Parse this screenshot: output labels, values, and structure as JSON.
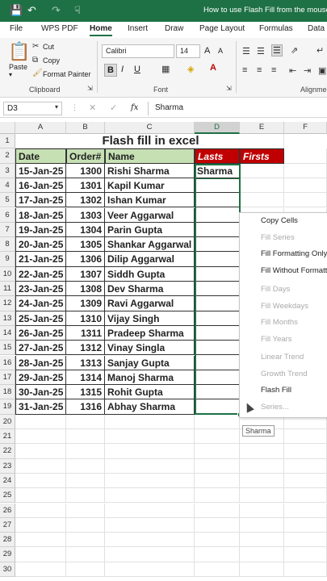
{
  "titlebar": {
    "title": "How to use Flash Fill from the mouse in",
    "save_icon": "save-icon",
    "undo_icon": "undo-icon",
    "redo_icon": "redo-icon"
  },
  "menu": {
    "tabs": [
      "File",
      "WPS PDF",
      "Home",
      "Insert",
      "Draw",
      "Page Layout",
      "Formulas",
      "Data"
    ],
    "active": "Home"
  },
  "ribbon": {
    "paste_label": "Paste",
    "cut_label": "Cut",
    "copy_label": "Copy",
    "format_painter_label": "Format Painter",
    "clipboard_label": "Clipboard",
    "font_name": "Calibri",
    "font_size": "14",
    "bold": "B",
    "italic": "I",
    "underline": "U",
    "font_label": "Font",
    "alignment_label": "Alignmen",
    "grow_font": "A",
    "shrink_font": "A",
    "accent": "#1e7145"
  },
  "formula_bar": {
    "name_box": "D3",
    "fx": "fx",
    "value": "Sharma"
  },
  "sheet": {
    "columns": [
      "A",
      "B",
      "C",
      "D",
      "E",
      "F"
    ],
    "title": "Flash fill in excel",
    "headers": {
      "date": "Date",
      "order": "Order#",
      "name": "Name",
      "lasts": "Lasts",
      "firsts": "Firsts"
    },
    "rows": [
      {
        "date": "15-Jan-25",
        "order": "1300",
        "name": "Rishi Sharma",
        "last": "Sharma"
      },
      {
        "date": "16-Jan-25",
        "order": "1301",
        "name": "Kapil Kumar",
        "last": ""
      },
      {
        "date": "17-Jan-25",
        "order": "1302",
        "name": "Ishan Kumar",
        "last": ""
      },
      {
        "date": "18-Jan-25",
        "order": "1303",
        "name": "Veer Aggarwal",
        "last": ""
      },
      {
        "date": "19-Jan-25",
        "order": "1304",
        "name": "Parin Gupta",
        "last": ""
      },
      {
        "date": "20-Jan-25",
        "order": "1305",
        "name": "Shankar Aggarwal",
        "last": ""
      },
      {
        "date": "21-Jan-25",
        "order": "1306",
        "name": "Dilip Aggarwal",
        "last": ""
      },
      {
        "date": "22-Jan-25",
        "order": "1307",
        "name": "Siddh Gupta",
        "last": ""
      },
      {
        "date": "23-Jan-25",
        "order": "1308",
        "name": "Dev Sharma",
        "last": ""
      },
      {
        "date": "24-Jan-25",
        "order": "1309",
        "name": "Ravi Aggarwal",
        "last": ""
      },
      {
        "date": "25-Jan-25",
        "order": "1310",
        "name": "Vijay Singh",
        "last": ""
      },
      {
        "date": "26-Jan-25",
        "order": "1311",
        "name": "Pradeep Sharma",
        "last": ""
      },
      {
        "date": "27-Jan-25",
        "order": "1312",
        "name": "Vinay Singla",
        "last": ""
      },
      {
        "date": "28-Jan-25",
        "order": "1313",
        "name": "Sanjay Gupta",
        "last": ""
      },
      {
        "date": "29-Jan-25",
        "order": "1314",
        "name": "Manoj Sharma",
        "last": ""
      },
      {
        "date": "30-Jan-25",
        "order": "1315",
        "name": "Rohit Gupta",
        "last": ""
      },
      {
        "date": "31-Jan-25",
        "order": "1316",
        "name": "Abhay Sharma",
        "last": ""
      }
    ],
    "row_numbers": [
      "1",
      "2",
      "3",
      "4",
      "5",
      "6",
      "7",
      "8",
      "9",
      "10",
      "11",
      "12",
      "13",
      "14",
      "15",
      "16",
      "17",
      "18",
      "19",
      "20",
      "21",
      "22",
      "23",
      "24",
      "25",
      "26",
      "27",
      "28",
      "29",
      "30"
    ],
    "header_green": "#c6e0b4",
    "header_red": "#c00000"
  },
  "context_menu": {
    "items": [
      {
        "label": "Copy Cells",
        "enabled": true
      },
      {
        "label": "Fill Series",
        "enabled": false
      },
      {
        "label": "Fill Formatting Only",
        "enabled": true
      },
      {
        "label": "Fill Without Formatting",
        "enabled": true
      },
      {
        "label": "Fill Days",
        "enabled": false
      },
      {
        "label": "Fill Weekdays",
        "enabled": false
      },
      {
        "label": "Fill Months",
        "enabled": false
      },
      {
        "label": "Fill Years",
        "enabled": false
      },
      {
        "label": "Linear Trend",
        "enabled": false
      },
      {
        "label": "Growth Trend",
        "enabled": false
      },
      {
        "label": "Flash Fill",
        "enabled": true
      },
      {
        "label": "Series...",
        "enabled": false
      }
    ]
  },
  "tooltip": "Sharma"
}
